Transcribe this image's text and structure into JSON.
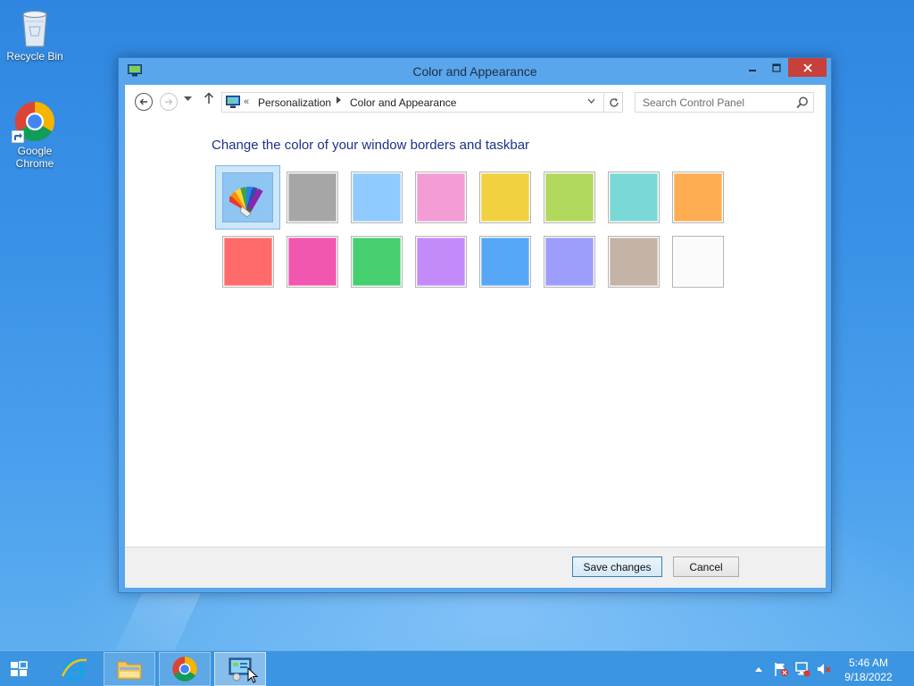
{
  "desktop": {
    "icons": [
      {
        "label": "Recycle Bin",
        "icon": "recycle-bin-icon"
      },
      {
        "label": "Google Chrome",
        "icon": "chrome-icon"
      }
    ]
  },
  "window": {
    "title": "Color and Appearance",
    "breadcrumb": {
      "overflow": "«",
      "items": [
        "Personalization",
        "Color and Appearance"
      ]
    },
    "search": {
      "placeholder": "Search Control Panel"
    },
    "heading": "Change the color of your window borders and taskbar",
    "swatches": [
      {
        "id": "automatic",
        "color": "#8fc5f2",
        "selected": true,
        "icon": "color-palette-icon"
      },
      {
        "id": "gray",
        "color": "#a6a6a6"
      },
      {
        "id": "light-blue",
        "color": "#8fcbff"
      },
      {
        "id": "pink",
        "color": "#f49cd6"
      },
      {
        "id": "yellow",
        "color": "#f2d13f"
      },
      {
        "id": "lime",
        "color": "#b0d85c"
      },
      {
        "id": "teal",
        "color": "#7ad9d6"
      },
      {
        "id": "orange",
        "color": "#ffad52"
      },
      {
        "id": "red",
        "color": "#ff6b6b"
      },
      {
        "id": "magenta",
        "color": "#f257b0"
      },
      {
        "id": "green",
        "color": "#45cf6f"
      },
      {
        "id": "purple",
        "color": "#c38bfa"
      },
      {
        "id": "blue",
        "color": "#56a8f7"
      },
      {
        "id": "periwinkle",
        "color": "#9d9dfb"
      },
      {
        "id": "taupe",
        "color": "#c3b4a5"
      },
      {
        "id": "white",
        "color": "#fafafa"
      }
    ],
    "buttons": {
      "save": "Save changes",
      "cancel": "Cancel"
    }
  },
  "taskbar": {
    "items": [
      "internet-explorer",
      "file-explorer",
      "chrome",
      "control-panel"
    ],
    "active_item": "control-panel",
    "clock": {
      "time": "5:46 AM",
      "date": "9/18/2022"
    }
  },
  "colors": {
    "accent": "#5aa6ec",
    "heading": "#1e3287"
  }
}
